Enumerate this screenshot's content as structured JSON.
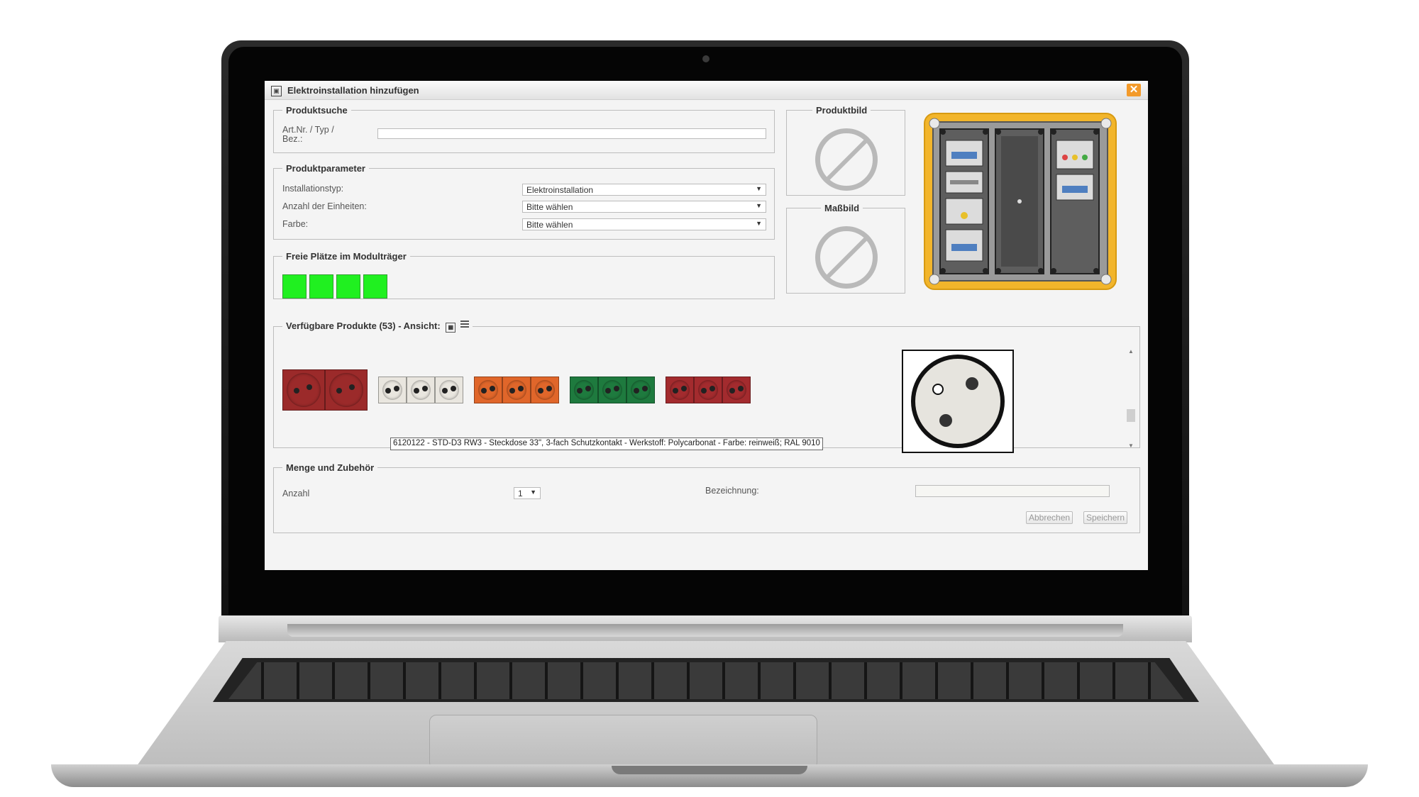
{
  "window": {
    "title": "Elektroinstallation hinzufügen",
    "close_glyph": "✕"
  },
  "produktsuche": {
    "legend": "Produktsuche",
    "label": "Art.Nr. / Typ / Bez.:",
    "value": ""
  },
  "produktparameter": {
    "legend": "Produktparameter",
    "rows": [
      {
        "label": "Installationstyp:",
        "value": "Elektroinstallation"
      },
      {
        "label": "Anzahl der Einheiten:",
        "value": "Bitte wählen"
      },
      {
        "label": "Farbe:",
        "value": "Bitte wählen"
      }
    ]
  },
  "freie_plaetze": {
    "legend": "Freie Plätze im Modulträger",
    "slot_count": 4,
    "slot_color": "#20f020"
  },
  "produktbild": {
    "legend": "Produktbild"
  },
  "massbild": {
    "legend": "Maßbild"
  },
  "verfuegbare": {
    "legend": "Verfügbare Produkte (53) - Ansicht:",
    "tooltip": "6120122 - STD-D3 RW3 - Steckdose 33\", 3-fach Schutzkontakt - Werkstoff: Polycarbonat - Farbe: reinweiß; RAL 9010",
    "products": [
      {
        "color": "#9b2a2a",
        "count": 2
      },
      {
        "color": "#e9e6df",
        "count": 3
      },
      {
        "color": "#e0662a",
        "count": 3
      },
      {
        "color": "#1e7a3e",
        "count": 3
      },
      {
        "color": "#a32b2e",
        "count": 3
      }
    ]
  },
  "menge": {
    "legend": "Menge und Zubehör",
    "anzahl_label": "Anzahl",
    "anzahl_value": "1",
    "bezeichnung_label": "Bezeichnung:",
    "bezeichnung_value": "",
    "cancel_label": "Abbrechen",
    "save_label": "Speichern"
  },
  "colors": {
    "accent": "#f39a2a",
    "panel_frame": "#f2b52b"
  }
}
